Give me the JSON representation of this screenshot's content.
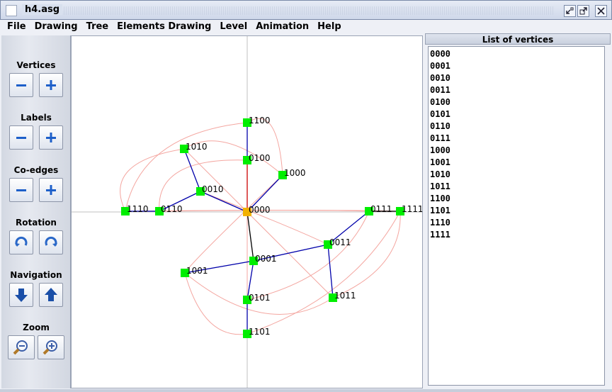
{
  "window": {
    "title": "h4.asg",
    "icons": [
      "app-icon",
      "minimize-icon",
      "maximize-icon",
      "close-icon"
    ]
  },
  "menu": [
    "File",
    "Drawing",
    "Tree",
    "Elements Drawing",
    "Level",
    "Animation",
    "Help"
  ],
  "toolbar": {
    "vertices_label": "Vertices",
    "labels_label": "Labels",
    "coedges_label": "Co-edges",
    "rotation_label": "Rotation",
    "navigation_label": "Navigation",
    "zoom_label": "Zoom"
  },
  "panel": {
    "title": "List of vertices",
    "vertices": [
      "0000",
      "0001",
      "0010",
      "0011",
      "0100",
      "0101",
      "0110",
      "0111",
      "1000",
      "1001",
      "1010",
      "1011",
      "1100",
      "1101",
      "1110",
      "1111"
    ]
  },
  "graph": {
    "colors": {
      "root": "#f2b100",
      "node": "#00ee00",
      "tree_edge": "#0000aa",
      "root_edge": "#000000",
      "special_edge": "#cc0000",
      "co_edge": "#f4a6a0",
      "axis": "#c0c0c0"
    },
    "root": "0000"
  }
}
